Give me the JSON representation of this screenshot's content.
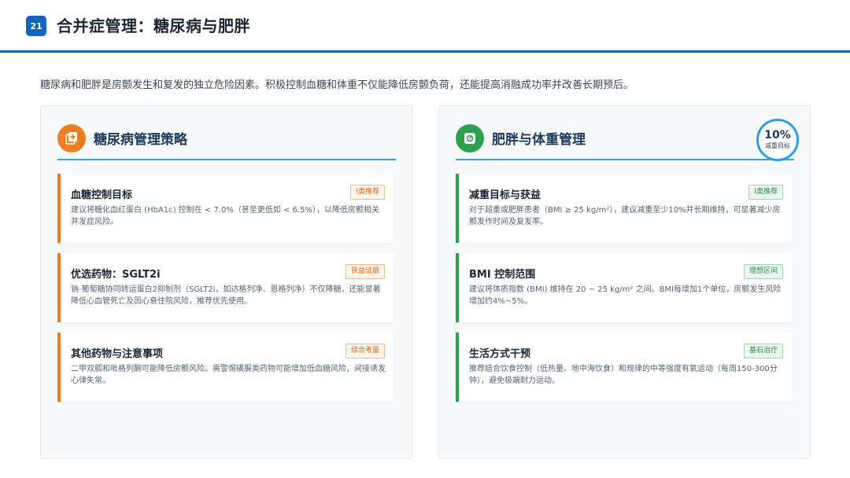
{
  "header": {
    "page_number": "21",
    "title": "合并症管理：糖尿病与肥胖"
  },
  "intro": "糖尿病和肥胖是房颤发生和复发的独立危险因素。积极控制血糖和体重不仅能降低房颤负荷，还能提高消融成功率并改善长期预后。",
  "colors": {
    "primary_blue": "#1565c0",
    "orange": "#ef7d22",
    "green": "#2e9e4f"
  },
  "left_panel": {
    "icon": "plus-document-icon",
    "title": "糖尿病管理策略",
    "cards": [
      {
        "title": "血糖控制目标",
        "tag": "I类推荐",
        "desc": "建议将糖化血红蛋白 (HbA1c) 控制在 < 7.0%（甚至更低如 < 6.5%），以降低房颤相关并发症风险。"
      },
      {
        "title": "优选药物：SGLT2i",
        "tag": "获益证据",
        "desc": "钠-葡萄糖协同转运蛋白2抑制剂（SGLT2i，如达格列净、恩格列净）不仅降糖，还能显著降低心血管死亡及因心衰住院风险，推荐优先使用。"
      },
      {
        "title": "其他药物与注意事项",
        "tag": "综合考量",
        "desc": "二甲双胍和吡格列酮可能降低房颤风险。需警惕磺脲类药物可能增加低血糖风险，间接诱发心律失常。"
      }
    ]
  },
  "right_panel": {
    "icon": "weight-scale-icon",
    "title": "肥胖与体重管理",
    "badge": {
      "value": "10%",
      "label": "减重目标"
    },
    "cards": [
      {
        "title": "减重目标与获益",
        "tag": "I类推荐",
        "desc": "对于超重或肥胖患者（BMI ≥ 25 kg/m²），建议减重至少10%并长期维持，可显著减少房颤发作时间及复发率。"
      },
      {
        "title": "BMI 控制范围",
        "tag": "理想区间",
        "desc": "建议将体质指数 (BMI) 维持在 20 ~ 25 kg/m² 之间。BMI每增加1个单位，房颤发生风险增加约4%~5%。"
      },
      {
        "title": "生活方式干预",
        "tag": "基石治疗",
        "desc": "推荐结合饮食控制（低热量、地中海饮食）和规律的中等强度有氧运动（每周150-300分钟），避免极端耐力运动。"
      }
    ]
  }
}
